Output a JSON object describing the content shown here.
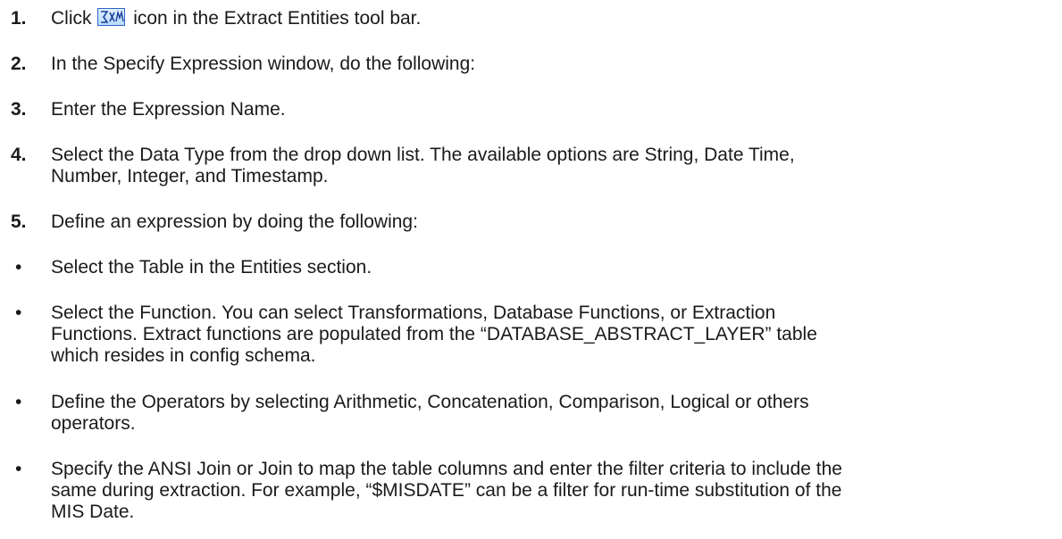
{
  "steps": [
    {
      "num": "1.",
      "before_icon": "Click",
      "icon": "expression-icon",
      "after_icon": "icon in the Extract Entities tool bar."
    },
    {
      "num": "2.",
      "text": "In the Specify Expression window, do the following:"
    },
    {
      "num": "3.",
      "text": "Enter the Expression Name."
    },
    {
      "num": "4.",
      "text_line1": "Select the Data Type from the drop down list. The available options are String, Date Time,",
      "text_line2": "Number, Integer, and Timestamp."
    },
    {
      "num": "5.",
      "text": "Define an expression by doing the following:"
    }
  ],
  "bullets": [
    {
      "symbol": "•",
      "lines": [
        "Select the Table in the Entities section."
      ]
    },
    {
      "symbol": "•",
      "lines": [
        "Select the Function. You can select Transformations, Database Functions, or Extraction",
        "Functions. Extract functions are populated from the “DATABASE_ABSTRACT_LAYER” table",
        "which resides in config schema."
      ]
    },
    {
      "symbol": "•",
      "lines": [
        "Define the Operators by selecting Arithmetic, Concatenation, Comparison, Logical or others",
        "operators."
      ]
    },
    {
      "symbol": "•",
      "lines": [
        "Specify the ANSI Join or Join to map the table columns and enter the filter criteria to include the",
        "same during extraction. For example, “$MISDATE” can be a filter for run-time substitution of the",
        "MIS Date."
      ]
    }
  ]
}
